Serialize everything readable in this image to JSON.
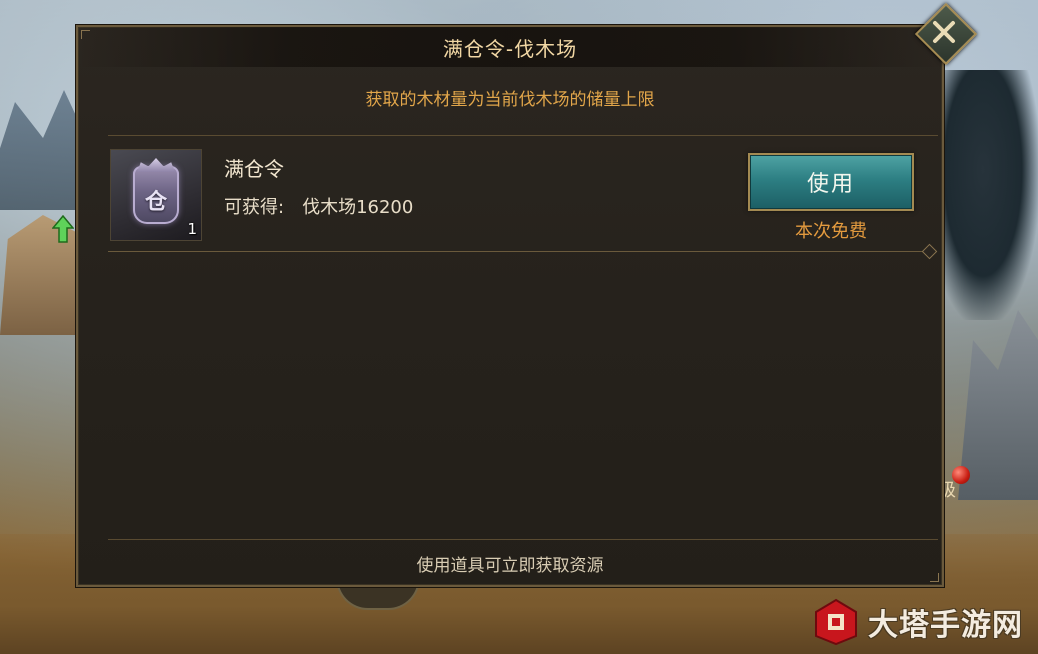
{
  "dialog": {
    "title": "满仓令-伐木场",
    "subtitle": "获取的木材量为当前伐木场的储量上限",
    "footer": "使用道具可立即获取资源"
  },
  "item": {
    "icon_glyph": "仓",
    "count": "1",
    "name": "满仓令",
    "gain_label": "可获得:",
    "gain_value": "伐木场16200",
    "use_button_label": "使用",
    "cost_note": "本次免费"
  },
  "close_button": {
    "icon": "close-icon"
  },
  "background": {
    "badge_text": "级"
  },
  "watermark": {
    "text": "大塔手游网"
  },
  "colors": {
    "title": "#f1d7a4",
    "subtitle": "#e2a64a",
    "button_teal": "#2d7f83",
    "free_text": "#e39a3e",
    "panel": "#26221c",
    "border_gold": "#6b5a3c"
  }
}
